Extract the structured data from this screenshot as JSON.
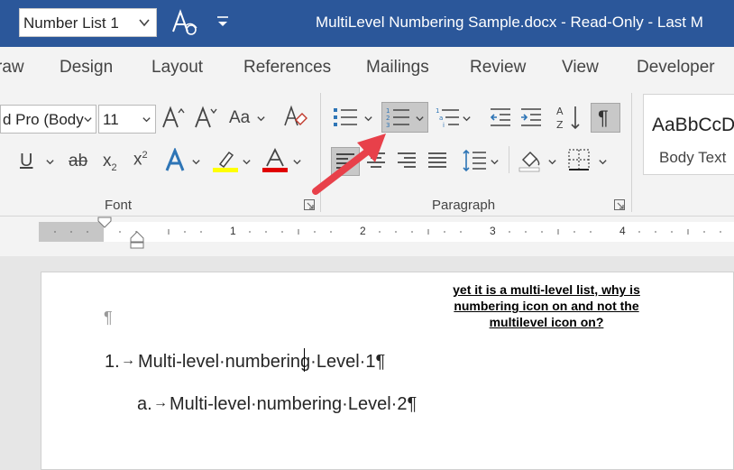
{
  "titlebar": {
    "style_box_value": "Number List 1",
    "document_title": "MultiLevel Numbering Sample.docx  -  Read-Only  -  Last M"
  },
  "tabs": [
    "raw",
    "Design",
    "Layout",
    "References",
    "Mailings",
    "Review",
    "View",
    "Developer"
  ],
  "font_group": {
    "font_name": "d Pro (Body",
    "font_size": "11",
    "case_label": "Aa",
    "group_label": "Font",
    "highlight_color": "#ffff00",
    "font_color": "#e00000"
  },
  "paragraph_group": {
    "group_label": "Paragraph",
    "pilcrow": "¶"
  },
  "styles": {
    "preview": "AaBbCcD",
    "name": "Body Text"
  },
  "ruler": {
    "numbers": [
      "1",
      "2",
      "3",
      "4"
    ]
  },
  "document": {
    "empty_paragraph_mark": "¶",
    "line1_number": "1.",
    "line1_text": "Multi-level·numbering·Level·1¶",
    "line2_letter": "a.",
    "line2_text": "Multi-level·numbering·Level·2¶",
    "tab_arrow": "→"
  },
  "annotation": {
    "line1": "yet it is a multi-level list, why is",
    "line2": "numbering icon on and not the",
    "line3": "multilevel icon on?"
  },
  "colors": {
    "titlebar": "#2b579a",
    "arrow": "#e8404a",
    "text_effects_blue": "#2e75b6"
  }
}
